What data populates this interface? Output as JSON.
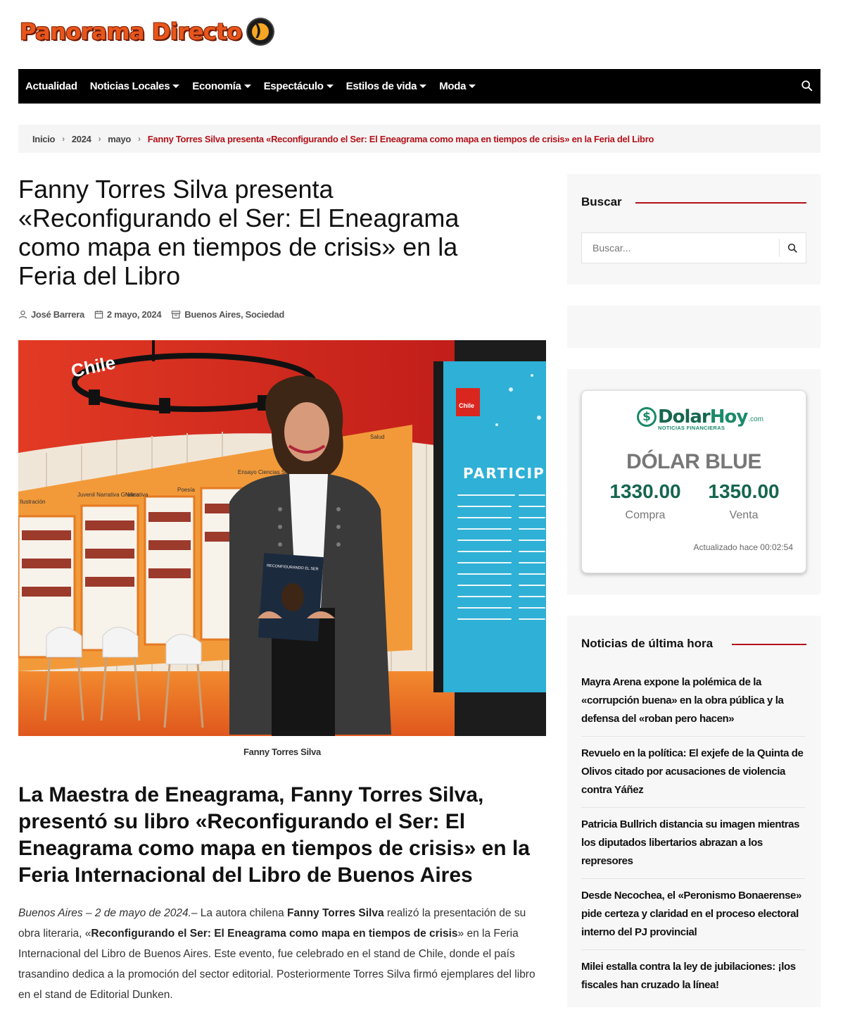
{
  "site": {
    "logo_text": "Panorama Directo"
  },
  "nav": {
    "items": [
      {
        "label": "Actualidad",
        "dropdown": false
      },
      {
        "label": "Noticias Locales",
        "dropdown": true
      },
      {
        "label": "Economía",
        "dropdown": true
      },
      {
        "label": "Espectáculo",
        "dropdown": true
      },
      {
        "label": "Estilos de vida",
        "dropdown": true
      },
      {
        "label": "Moda",
        "dropdown": true
      }
    ],
    "search_icon": "search-icon"
  },
  "breadcrumb": {
    "items": [
      "Inicio",
      "2024",
      "mayo"
    ],
    "current": "Fanny Torres Silva presenta «Reconfigurando el Ser: El Eneagrama como mapa en tiempos de crisis» en la Feria del Libro"
  },
  "article": {
    "title": "Fanny Torres Silva presenta «Reconfigurando el Ser: El Eneagrama como mapa en tiempos de crisis» en la Feria del Libro",
    "author": "José Barrera",
    "date": "2 mayo, 2024",
    "categories": "Buenos Aires, Sociedad",
    "image_caption": "Fanny Torres Silva",
    "subheading": "La Maestra de Eneagrama, Fanny Torres Silva, presentó su libro «Reconfigurando el Ser: El Eneagrama como mapa en tiempos de crisis» en la Feria Internacional del Libro de Buenos Aires",
    "dateline": "Buenos Aires – 2 de mayo de 2024.",
    "p1_a": "– La autora chilena ",
    "p1_author": "Fanny Torres Silva",
    "p1_b": " realizó la presentación de su obra literaria, «",
    "p1_book": "Reconfigurando el Ser: El Eneagrama como mapa en tiempos de crisis",
    "p1_c": "» en la Feria Internacional del Libro de Buenos Aires. Este evento, fue celebrado en el stand de Chile, donde el país trasandino dedica a la promoción del sector editorial. Posteriormente Torres Silva firmó ejemplares del libro en el stand de Editorial Dunken.",
    "photo_texts": {
      "chile": "Chile",
      "particip": "PARTICIP",
      "book_title": "RECONFIGURANDO EL SER",
      "shelf_labels": [
        "Ilustración",
        "Juvenil Narrativa Gráfica",
        "Narrativa",
        "Poesía",
        "Ensayo Ciencias Sociales",
        "Salud"
      ]
    }
  },
  "sidebar": {
    "search": {
      "title": "Buscar",
      "placeholder": "Buscar..."
    },
    "dolar": {
      "brand_dolar": "Dolar",
      "brand_hoy": "Hoy",
      "brand_com": ".com",
      "brand_sub": "NOTICIAS FINANCIERAS",
      "title": "DÓLAR BLUE",
      "compra_value": "1330.00",
      "compra_label": "Compra",
      "venta_value": "1350.00",
      "venta_label": "Venta",
      "updated": "Actualizado hace 00:02:54"
    },
    "news": {
      "title": "Noticias de última hora",
      "items": [
        "Mayra Arena expone la polémica de la «corrupción buena» en la obra pública y la defensa del «roban pero hacen»",
        "Revuelo en la política: El exjefe de la Quinta de Olivos citado por acusaciones de violencia contra Yáñez",
        "Patricia Bullrich distancia su imagen mientras los diputados libertarios abrazan a los represores",
        "Desde Necochea, el «Peronismo Bonaerense» pide certeza y claridad en el proceso electoral interno del PJ provincial",
        "Milei estalla contra la ley de jubilaciones: ¡los fiscales han cruzado la línea!"
      ]
    }
  },
  "colors": {
    "accent": "#b3121a",
    "nav_bg": "#000000",
    "dolar_green": "#16664f"
  }
}
